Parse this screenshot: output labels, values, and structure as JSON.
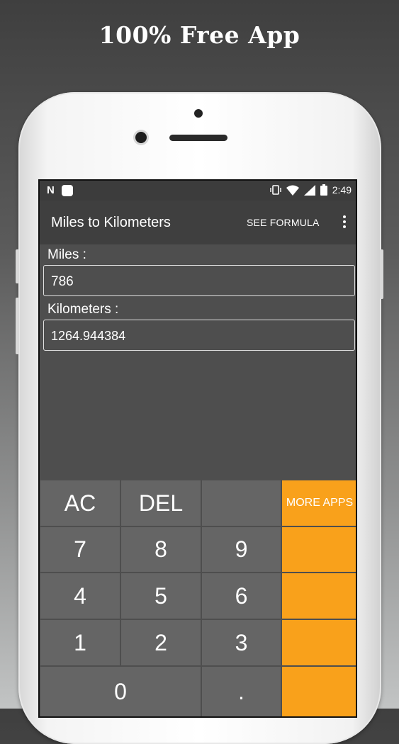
{
  "promo": {
    "headline": "100% Free App"
  },
  "status_bar": {
    "time": "2:49",
    "notification_letter": "N"
  },
  "app_bar": {
    "title": "Miles to Kilometers",
    "formula_button": "SEE FORMULA"
  },
  "converter": {
    "miles_label": "Miles :",
    "miles_value": "786",
    "km_label": "Kilometers :",
    "km_value": "1264.944384"
  },
  "keypad": {
    "ac": "AC",
    "del": "DEL",
    "more_apps": "MORE APPS",
    "k7": "7",
    "k8": "8",
    "k9": "9",
    "k4": "4",
    "k5": "5",
    "k6": "6",
    "k1": "1",
    "k2": "2",
    "k3": "3",
    "k0": "0",
    "dot": "."
  },
  "colors": {
    "accent": "#f9a11b",
    "key_bg": "#656565",
    "screen_bg": "#4e4e4e"
  }
}
